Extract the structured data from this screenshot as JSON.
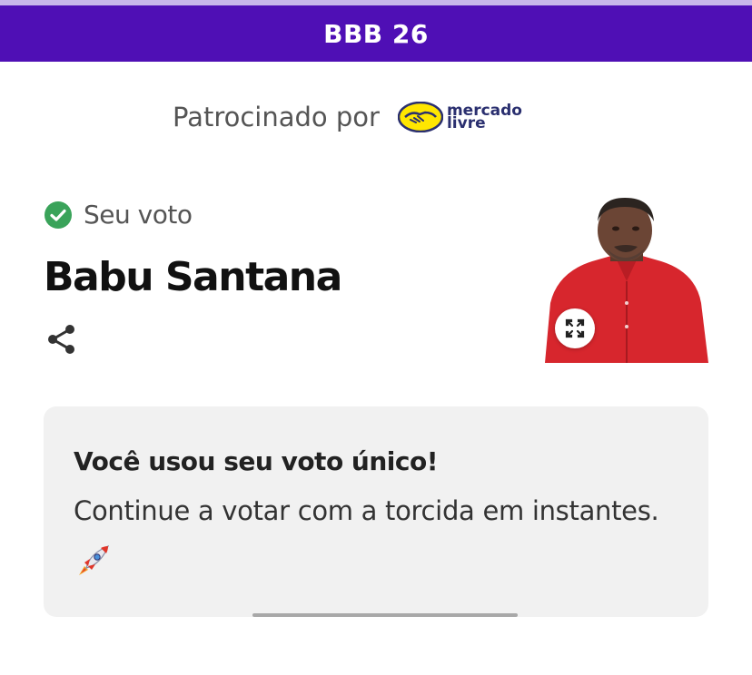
{
  "header": {
    "title": "BBB 26"
  },
  "sponsor": {
    "label": "Patrocinado por",
    "logo_text_line1": "mercado",
    "logo_text_line2": "livre"
  },
  "vote": {
    "status": "Seu voto",
    "candidate": "Babu Santana"
  },
  "card": {
    "title": "Você usou seu voto único!",
    "body": "Continue a votar com a torcida em instantes."
  },
  "colors": {
    "header_bg": "#4f0fb5",
    "check_green": "#3aa35a",
    "card_bg": "#f1f1f1"
  },
  "icons": [
    "check-circle-icon",
    "share-icon",
    "expand-icon",
    "rocket-icon",
    "mercado-livre-logo"
  ]
}
